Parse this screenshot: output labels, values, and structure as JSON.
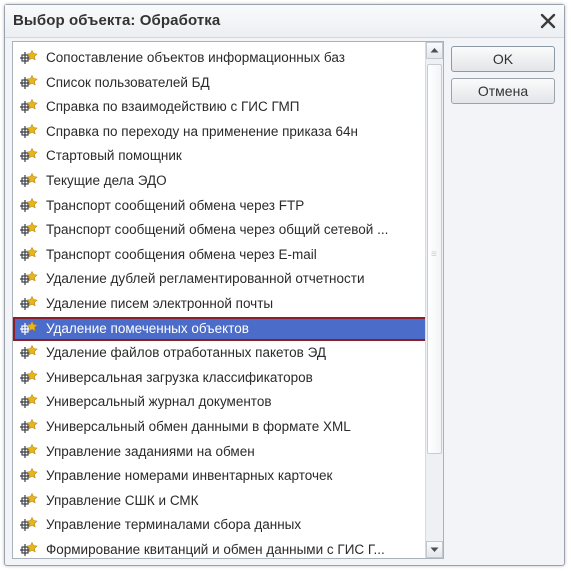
{
  "window": {
    "title": "Выбор объекта: Обработка",
    "close_icon": "close-icon"
  },
  "buttons": {
    "ok_label": "OK",
    "cancel_label": "Отмена"
  },
  "list": {
    "item_icon": "data-processor-icon",
    "selected_index": 11,
    "items": [
      "Сопоставление объектов информационных баз",
      "Список пользователей БД",
      "Справка по взаимодействию с ГИС ГМП",
      "Справка по переходу на применение приказа 64н",
      "Стартовый помощник",
      "Текущие дела ЭДО",
      "Транспорт сообщений обмена через FTP",
      "Транспорт сообщений обмена через общий сетевой ...",
      "Транспорт сообщения обмена через E-mail",
      "Удаление дублей регламентированной отчетности",
      "Удаление писем электронной почты",
      "Удаление помеченных объектов",
      "Удаление файлов отработанных пакетов ЭД",
      "Универсальная загрузка классификаторов",
      "Универсальный журнал документов",
      "Универсальный обмен данными в формате XML",
      "Управление заданиями на обмен",
      "Управление номерами инвентарных карточек",
      "Управление СШК и СМК",
      "Управление терминалами сбора данных",
      "Формирование квитанций и обмен данными с ГИС Г..."
    ]
  },
  "colors": {
    "selection": "#4b6cc8",
    "selection_border": "#8a1f26",
    "icon_gold": "#e8b51c",
    "icon_dark": "#3a3f47"
  }
}
